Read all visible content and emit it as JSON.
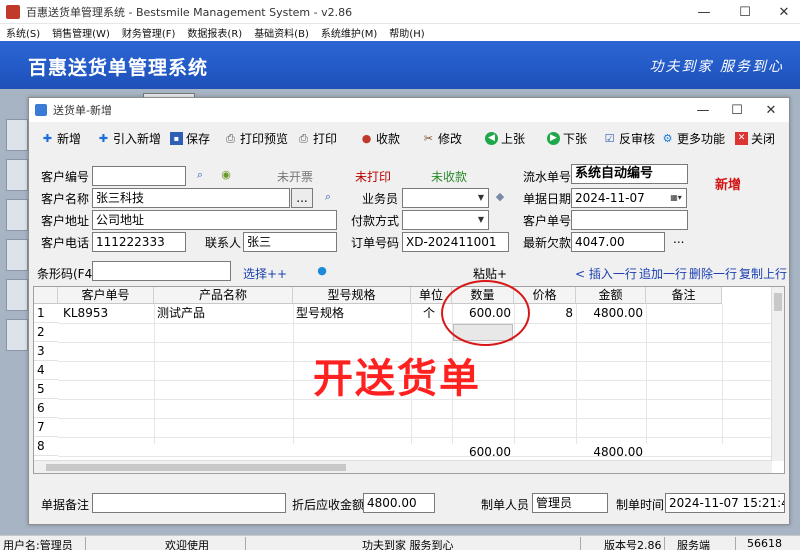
{
  "app": {
    "window_title": "百惠送货单管理系统 - Bestsmile Management System - v2.86",
    "menu": [
      "系统(S)",
      "销售管理(W)",
      "财务管理(F)",
      "数据报表(R)",
      "基础资料(B)",
      "系统维护(M)",
      "帮助(H)"
    ],
    "banner_title": "百惠送货单管理系统",
    "banner_slogan": "功夫到家 服务到心"
  },
  "dialog": {
    "title": "送货单-新增",
    "mode_label": "新增",
    "toolbar": {
      "new": "新增",
      "import_new": "引入新增",
      "save": "保存",
      "print_preview": "打印预览",
      "print": "打印",
      "receive": "收款",
      "modify": "修改",
      "prev": "上张",
      "next": "下张",
      "unapprove": "反审核",
      "more": "更多功能",
      "close": "关闭"
    },
    "form": {
      "customer_code_label": "客户编号",
      "customer_code": "",
      "status_invoice": "未开票",
      "status_print": "未打印",
      "status_payment": "未收款",
      "serial_no_label": "流水单号",
      "serial_no": "系统自动编号",
      "customer_name_label": "客户名称",
      "customer_name": "张三科技",
      "ellipsis": "...",
      "salesperson_label": "业务员",
      "salesperson": "",
      "doc_date_label": "单据日期",
      "doc_date": "2024-11-07",
      "customer_address_label": "客户地址",
      "customer_address": "公司地址",
      "payment_method_label": "付款方式",
      "payment_method": "",
      "customer_order_label": "客户单号",
      "customer_order": "",
      "customer_phone_label": "客户电话",
      "customer_phone": "111222333",
      "contact_label": "联系人",
      "contact": "张三",
      "order_no_label": "订单号码",
      "order_no": "XD-202411001",
      "latest_debt_label": "最新欠款",
      "latest_debt": "4047.00"
    },
    "barcode": {
      "label": "条形码(F4)",
      "value": "",
      "select_btn": "选择++",
      "paste_btn": "粘贴+",
      "insert_row": "< 插入一行",
      "append_row": "追加一行",
      "delete_row": "删除一行",
      "copy_row": "复制上行"
    },
    "grid": {
      "columns": [
        "客户单号",
        "产品名称",
        "型号规格",
        "单位",
        "数量",
        "价格",
        "金额",
        "备注"
      ],
      "row_numbers": [
        "1",
        "2",
        "3",
        "4",
        "5",
        "6",
        "7",
        "8"
      ],
      "rows": [
        {
          "customer_no": "KL8953",
          "product": "测试产品",
          "spec": "型号规格",
          "unit": "个",
          "qty": "600.00",
          "price": "8",
          "amount": "4800.00",
          "note": ""
        }
      ],
      "totals": {
        "qty": "600.00",
        "amount": "4800.00"
      }
    },
    "footer": {
      "remark_label": "单据备注",
      "remark": "",
      "discount_label": "折后应收金额",
      "discount_amount": "4800.00",
      "creator_label": "制单人员",
      "creator": "管理员",
      "created_time_label": "制单时间",
      "created_time": "2024-11-07 15:21:45"
    }
  },
  "annotation": {
    "text": "开送货单"
  },
  "statusbar": {
    "user": "用户名:管理员",
    "welcome": "欢迎使用",
    "slogan": "功夫到家 服务到心",
    "version": "版本号2.86",
    "side": "服务端",
    "code": "56618"
  }
}
